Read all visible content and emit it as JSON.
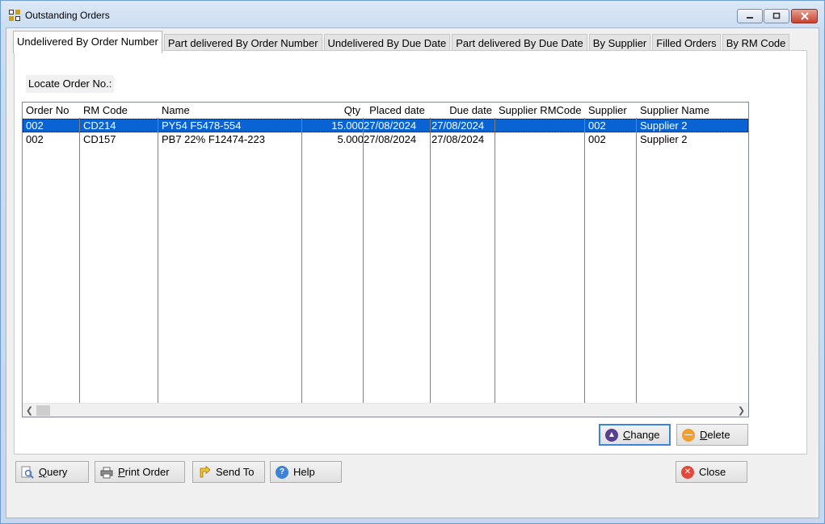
{
  "window": {
    "title": "Outstanding Orders"
  },
  "tabs": [
    {
      "label": "Undelivered By Order Number",
      "active": true
    },
    {
      "label": "Part delivered By Order Number",
      "active": false
    },
    {
      "label": "Undelivered By Due Date",
      "active": false
    },
    {
      "label": "Part delivered By Due Date",
      "active": false
    },
    {
      "label": "By Supplier",
      "active": false
    },
    {
      "label": "Filled Orders",
      "active": false
    },
    {
      "label": "By RM Code",
      "active": false
    }
  ],
  "locate": {
    "label": "Locate Order No.:"
  },
  "grid": {
    "columns": [
      "Order No",
      "RM Code",
      "Name",
      "Qty",
      "Placed date",
      "Due date",
      "Supplier RMCode",
      "Supplier",
      "Supplier Name"
    ],
    "rows": [
      {
        "order_no": "002",
        "rm_code": "CD214",
        "name": "PY54 F5478-554",
        "qty": "15.000",
        "placed": "27/08/2024",
        "due": "27/08/2024",
        "supplier_rmcode": "",
        "supplier": "002",
        "supplier_name": "Supplier 2",
        "selected": true
      },
      {
        "order_no": "002",
        "rm_code": "CD157",
        "name": "PB7 22% F12474-223",
        "qty": "5.000",
        "placed": "27/08/2024",
        "due": "27/08/2024",
        "supplier_rmcode": "",
        "supplier": "002",
        "supplier_name": "Supplier 2",
        "selected": false
      }
    ]
  },
  "buttons": {
    "change": {
      "label_u": "C",
      "label_rest": "hange"
    },
    "delete": {
      "label_u": "D",
      "label_rest": "elete"
    },
    "query": {
      "label_u": "Q",
      "label_rest": "uery"
    },
    "print_order": {
      "label_u": "P",
      "label_rest": "rint Order"
    },
    "send_to": {
      "label": "Send To"
    },
    "help": {
      "label": "Help"
    },
    "close": {
      "label": "Close"
    }
  },
  "colors": {
    "selection": "#0a63d2",
    "change_icon": "#5a3f8e",
    "delete_icon": "#f0a030",
    "close_icon": "#e04a3a",
    "help_icon": "#3c82d6"
  }
}
